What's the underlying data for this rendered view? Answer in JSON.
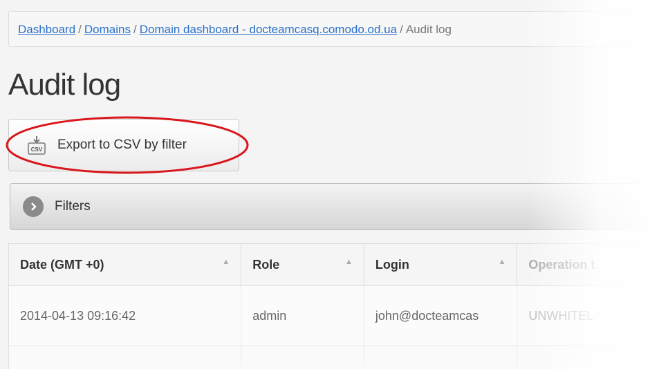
{
  "breadcrumb": {
    "items": [
      "Dashboard",
      "Domains",
      "Domain dashboard - docteamcasq.comodo.od.ua"
    ],
    "separator": "/",
    "current": "Audit log"
  },
  "page_title": "Audit log",
  "export_button": {
    "label": "Export to CSV by filter",
    "icon": "csv-export-icon"
  },
  "filters": {
    "label": "Filters",
    "icon": "chevron-right-icon"
  },
  "table": {
    "columns": [
      "Date (GMT +0)",
      "Role",
      "Login",
      "Operation t"
    ],
    "rows": [
      [
        "2014-04-13 09:16:42",
        "admin",
        "john@docteamcas",
        "UNWHITEL"
      ]
    ]
  },
  "colors": {
    "link": "#2a6fc9",
    "highlight": "#d8161b"
  }
}
